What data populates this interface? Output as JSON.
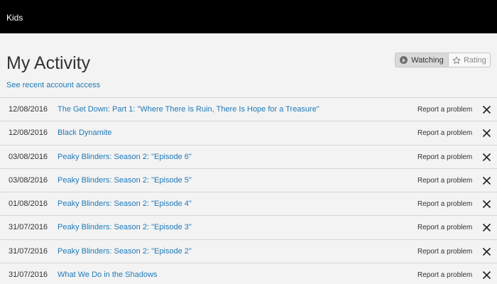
{
  "header": {
    "profile_name": "Kids"
  },
  "main": {
    "title": "My Activity",
    "toggle": {
      "watching_label": "Watching",
      "rating_label": "Rating"
    },
    "account_access_link": "See recent account access",
    "rows": [
      {
        "date": "12/08/2016",
        "title": "The Get Down: Part 1: \"Where There Is Ruin, There Is Hope for a Treasure\"",
        "report": "Report a problem"
      },
      {
        "date": "12/08/2016",
        "title": "Black Dynamite",
        "report": "Report a problem"
      },
      {
        "date": "03/08/2016",
        "title": "Peaky Blinders: Season 2: \"Episode 6\"",
        "report": "Report a problem"
      },
      {
        "date": "03/08/2016",
        "title": "Peaky Blinders: Season 2: \"Episode 5\"",
        "report": "Report a problem"
      },
      {
        "date": "01/08/2016",
        "title": "Peaky Blinders: Season 2: \"Episode 4\"",
        "report": "Report a problem"
      },
      {
        "date": "31/07/2016",
        "title": "Peaky Blinders: Season 2: \"Episode 3\"",
        "report": "Report a problem"
      },
      {
        "date": "31/07/2016",
        "title": "Peaky Blinders: Season 2: \"Episode 2\"",
        "report": "Report a problem"
      },
      {
        "date": "31/07/2016",
        "title": "What We Do in the Shadows",
        "report": "Report a problem"
      }
    ]
  },
  "icons": {
    "watching": "play-circle-icon",
    "rating": "star-icon",
    "remove": "close-icon"
  },
  "colors": {
    "header_bg": "#000000",
    "link": "#1f7ab8",
    "page_bg": "#f3f3f3"
  }
}
